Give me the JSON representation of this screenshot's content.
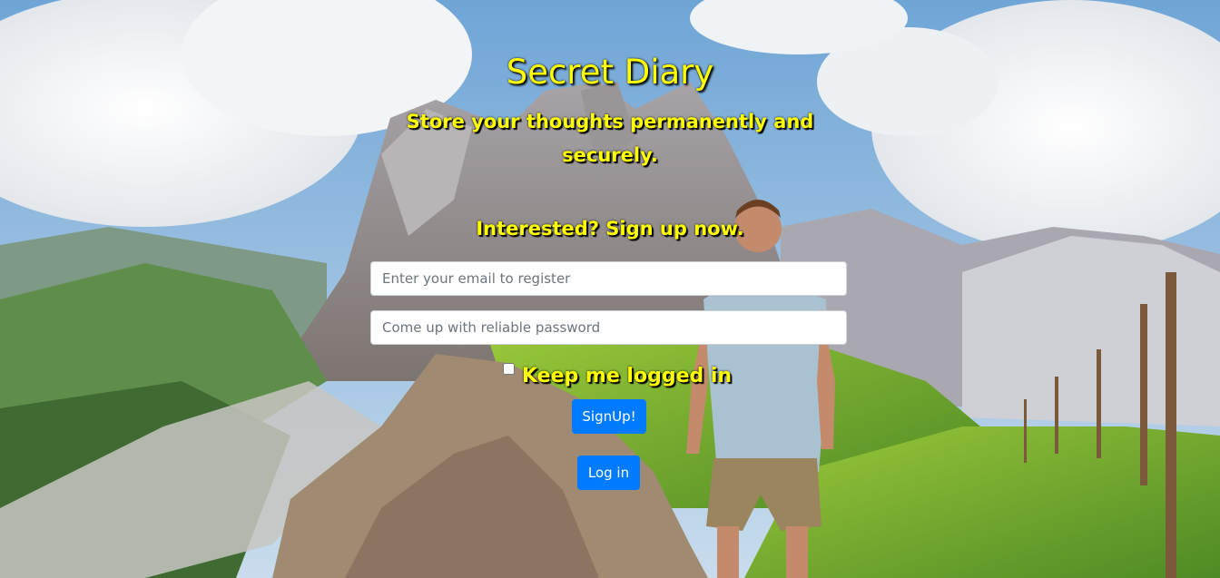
{
  "page": {
    "title": "Secret Diary",
    "subtitle": "Store your thoughts permanently and securely.",
    "cta": "Interested? Sign up now."
  },
  "form": {
    "email_placeholder": "Enter your email to register",
    "password_placeholder": "Come up with reliable password",
    "keep_logged_in_label": "Keep me logged in",
    "keep_logged_in_checked": false,
    "signup_label": "SignUp!",
    "login_label": "Log in"
  },
  "colors": {
    "heading_yellow": "#ffff00",
    "button_blue": "#007bff"
  }
}
